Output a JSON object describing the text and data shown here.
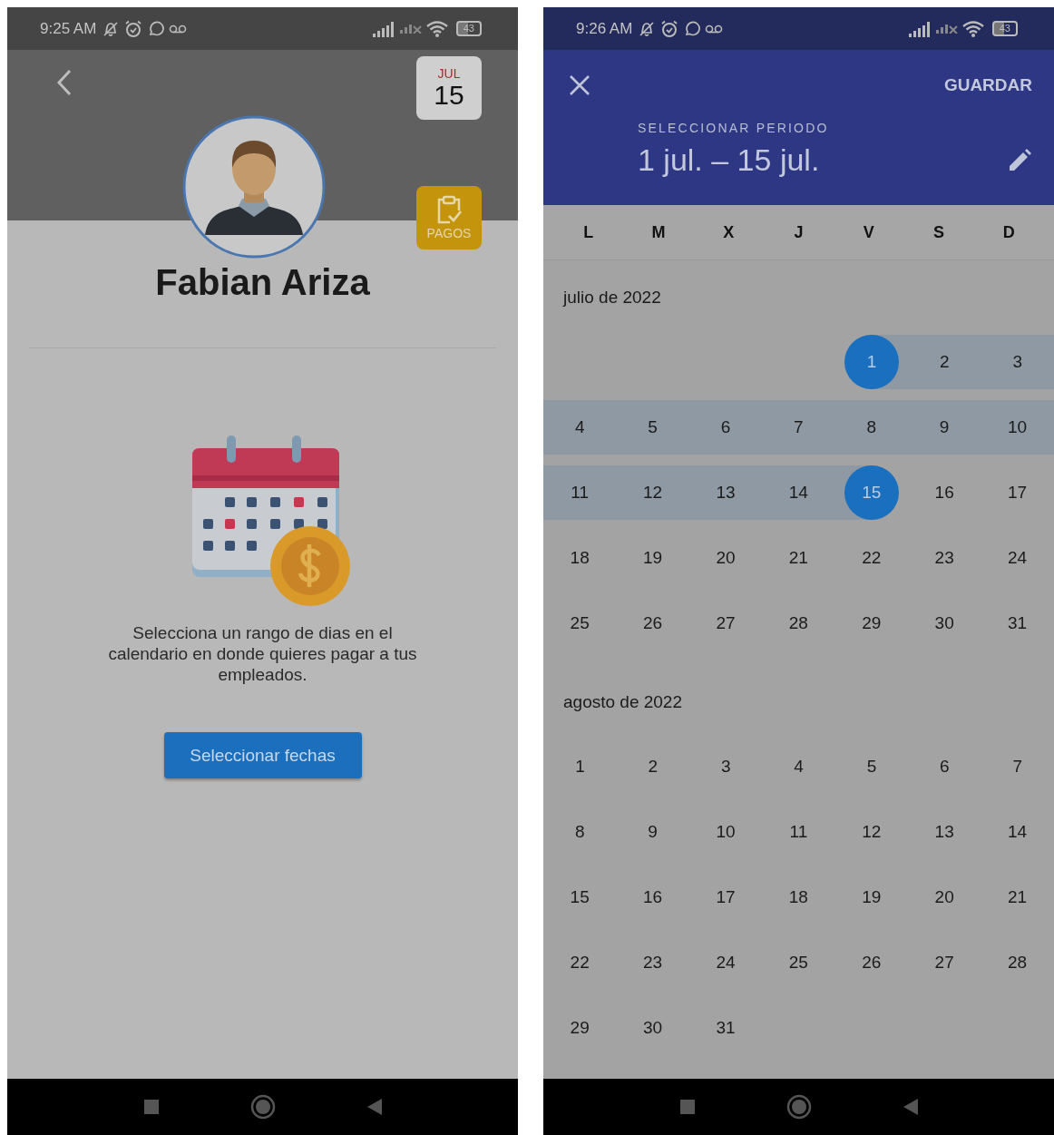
{
  "profile_screen": {
    "status_bar": {
      "time": "9:25 AM",
      "battery": "43"
    },
    "date_badge": {
      "month": "JUL",
      "day": "15"
    },
    "payments_button": {
      "label": "PAGOS"
    },
    "name": "Fabian Ariza",
    "message": "Selecciona un rango de dias en el calendario en donde quieres pagar a tus empleados.",
    "primary_button": {
      "label": "Seleccionar fechas"
    }
  },
  "date_picker_screen": {
    "status_bar": {
      "time": "9:26 AM",
      "battery": "43"
    },
    "save_button": {
      "label": "GUARDAR"
    },
    "title": "SELECCIONAR PERIODO",
    "range": "1 jul. – 15 jul.",
    "weekdays": [
      "L",
      "M",
      "X",
      "J",
      "V",
      "S",
      "D"
    ],
    "months": [
      {
        "title": "julio de 2022",
        "weeks": [
          [
            {
              "label": "1",
              "selected": true,
              "in_range": true
            },
            {
              "label": "2",
              "selected": false,
              "in_range": true
            },
            {
              "label": "3",
              "selected": false,
              "in_range": true
            }
          ],
          [
            {
              "label": "4",
              "selected": false,
              "in_range": true
            },
            {
              "label": "5",
              "selected": false,
              "in_range": true
            },
            {
              "label": "6",
              "selected": false,
              "in_range": true
            },
            {
              "label": "7",
              "selected": false,
              "in_range": true
            },
            {
              "label": "8",
              "selected": false,
              "in_range": true
            },
            {
              "label": "9",
              "selected": false,
              "in_range": true
            },
            {
              "label": "10",
              "selected": false,
              "in_range": true
            }
          ],
          [
            {
              "label": "11",
              "selected": false,
              "in_range": true
            },
            {
              "label": "12",
              "selected": false,
              "in_range": true
            },
            {
              "label": "13",
              "selected": false,
              "in_range": true
            },
            {
              "label": "14",
              "selected": false,
              "in_range": true
            },
            {
              "label": "15",
              "selected": true,
              "in_range": true
            },
            {
              "label": "16",
              "selected": false,
              "in_range": false
            },
            {
              "label": "17",
              "selected": false,
              "in_range": false
            }
          ],
          [
            {
              "label": "18",
              "selected": false,
              "in_range": false
            },
            {
              "label": "19",
              "selected": false,
              "in_range": false
            },
            {
              "label": "20",
              "selected": false,
              "in_range": false
            },
            {
              "label": "21",
              "selected": false,
              "in_range": false
            },
            {
              "label": "22",
              "selected": false,
              "in_range": false
            },
            {
              "label": "23",
              "selected": false,
              "in_range": false
            },
            {
              "label": "24",
              "selected": false,
              "in_range": false
            }
          ],
          [
            {
              "label": "25",
              "selected": false,
              "in_range": false
            },
            {
              "label": "26",
              "selected": false,
              "in_range": false
            },
            {
              "label": "27",
              "selected": false,
              "in_range": false
            },
            {
              "label": "28",
              "selected": false,
              "in_range": false
            },
            {
              "label": "29",
              "selected": false,
              "in_range": false
            },
            {
              "label": "30",
              "selected": false,
              "in_range": false
            },
            {
              "label": "31",
              "selected": false,
              "in_range": false
            }
          ]
        ]
      },
      {
        "title": "agosto de 2022",
        "weeks": [
          [
            {
              "label": "1",
              "selected": false,
              "in_range": false
            },
            {
              "label": "2",
              "selected": false,
              "in_range": false
            },
            {
              "label": "3",
              "selected": false,
              "in_range": false
            },
            {
              "label": "4",
              "selected": false,
              "in_range": false
            },
            {
              "label": "5",
              "selected": false,
              "in_range": false
            },
            {
              "label": "6",
              "selected": false,
              "in_range": false
            },
            {
              "label": "7",
              "selected": false,
              "in_range": false
            }
          ],
          [
            {
              "label": "8",
              "selected": false,
              "in_range": false
            },
            {
              "label": "9",
              "selected": false,
              "in_range": false
            },
            {
              "label": "10",
              "selected": false,
              "in_range": false
            },
            {
              "label": "11",
              "selected": false,
              "in_range": false
            },
            {
              "label": "12",
              "selected": false,
              "in_range": false
            },
            {
              "label": "13",
              "selected": false,
              "in_range": false
            },
            {
              "label": "14",
              "selected": false,
              "in_range": false
            }
          ],
          [
            {
              "label": "15",
              "selected": false,
              "in_range": false
            },
            {
              "label": "16",
              "selected": false,
              "in_range": false
            },
            {
              "label": "17",
              "selected": false,
              "in_range": false
            },
            {
              "label": "18",
              "selected": false,
              "in_range": false
            },
            {
              "label": "19",
              "selected": false,
              "in_range": false
            },
            {
              "label": "20",
              "selected": false,
              "in_range": false
            },
            {
              "label": "21",
              "selected": false,
              "in_range": false
            }
          ],
          [
            {
              "label": "22",
              "selected": false,
              "in_range": false
            },
            {
              "label": "23",
              "selected": false,
              "in_range": false
            },
            {
              "label": "24",
              "selected": false,
              "in_range": false
            },
            {
              "label": "25",
              "selected": false,
              "in_range": false
            },
            {
              "label": "26",
              "selected": false,
              "in_range": false
            },
            {
              "label": "27",
              "selected": false,
              "in_range": false
            },
            {
              "label": "28",
              "selected": false,
              "in_range": false
            }
          ],
          [
            {
              "label": "29",
              "selected": false,
              "in_range": false
            },
            {
              "label": "30",
              "selected": false,
              "in_range": false
            },
            {
              "label": "31",
              "selected": false,
              "in_range": false
            }
          ]
        ]
      }
    ]
  }
}
